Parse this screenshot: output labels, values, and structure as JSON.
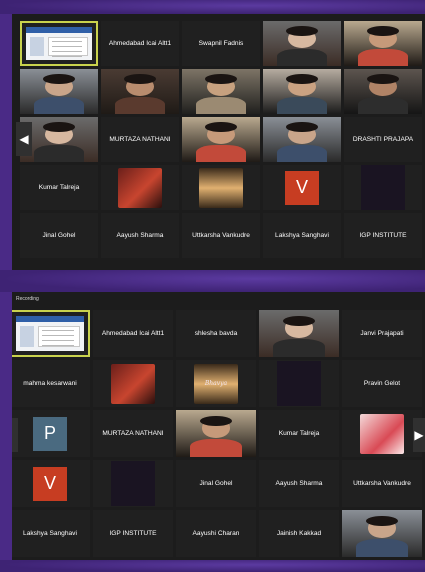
{
  "colors": {
    "background_purple": "#4a2a86",
    "tile_bg": "#202020",
    "active_speaker_border": "#c9d24d",
    "avatar_v": "#c73d22",
    "avatar_p": "#4a6a80"
  },
  "top_gallery": {
    "tiles": [
      {
        "kind": "share"
      },
      {
        "kind": "name",
        "name": "Ahmedabad Icai Altt1"
      },
      {
        "kind": "name",
        "name": "Swapnil Fadnis"
      },
      {
        "kind": "video"
      },
      {
        "kind": "video"
      },
      {
        "kind": "video"
      },
      {
        "kind": "video"
      },
      {
        "kind": "video"
      },
      {
        "kind": "video"
      },
      {
        "kind": "video"
      },
      {
        "kind": "video"
      },
      {
        "kind": "name",
        "name": "MURTAZA NATHANI"
      },
      {
        "kind": "video"
      },
      {
        "kind": "video"
      },
      {
        "kind": "name",
        "name": "DRASHTI PRAJAPA"
      },
      {
        "kind": "name",
        "name": "Kumar Talreja"
      },
      {
        "kind": "image"
      },
      {
        "kind": "image"
      },
      {
        "kind": "letter",
        "letter": "V"
      },
      {
        "kind": "dark"
      },
      {
        "kind": "name",
        "name": "Jinal Gohel"
      },
      {
        "kind": "name",
        "name": "Aayush Sharma"
      },
      {
        "kind": "name",
        "name": "Uttkarsha Vankudre"
      },
      {
        "kind": "name",
        "name": "Lakshya Sanghavi"
      },
      {
        "kind": "name",
        "name": "IGP INSTITUTE"
      }
    ]
  },
  "bottom_gallery": {
    "recording_label": "Recording",
    "tiles": [
      {
        "kind": "share"
      },
      {
        "kind": "name",
        "name": "Ahmedabad Icai Altt1"
      },
      {
        "kind": "name",
        "name": "shlesha bavda"
      },
      {
        "kind": "video"
      },
      {
        "kind": "name",
        "name": "Janvi Prajapati"
      },
      {
        "kind": "name",
        "name": "mahma kesarwani"
      },
      {
        "kind": "image"
      },
      {
        "kind": "image",
        "text": "Bhavya"
      },
      {
        "kind": "dark"
      },
      {
        "kind": "name",
        "name": "Pravin Gelot"
      },
      {
        "kind": "letter",
        "letter": "P"
      },
      {
        "kind": "name",
        "name": "MURTAZA NATHANI"
      },
      {
        "kind": "video"
      },
      {
        "kind": "name",
        "name": "Kumar Talreja"
      },
      {
        "kind": "image"
      },
      {
        "kind": "letter",
        "letter": "V"
      },
      {
        "kind": "dark"
      },
      {
        "kind": "name",
        "name": "Jinal Gohel"
      },
      {
        "kind": "name",
        "name": "Aayush Sharma"
      },
      {
        "kind": "name",
        "name": "Uttkarsha Vankudre"
      },
      {
        "kind": "name",
        "name": "Lakshya Sanghavi"
      },
      {
        "kind": "name",
        "name": "IGP INSTITUTE"
      },
      {
        "kind": "name",
        "name": "Aayushi Charan"
      },
      {
        "kind": "name",
        "name": "Jainish Kakkad"
      },
      {
        "kind": "video"
      }
    ]
  },
  "icons": {
    "prev_page": "chevron-left-icon",
    "next_page": "chevron-right-icon"
  }
}
